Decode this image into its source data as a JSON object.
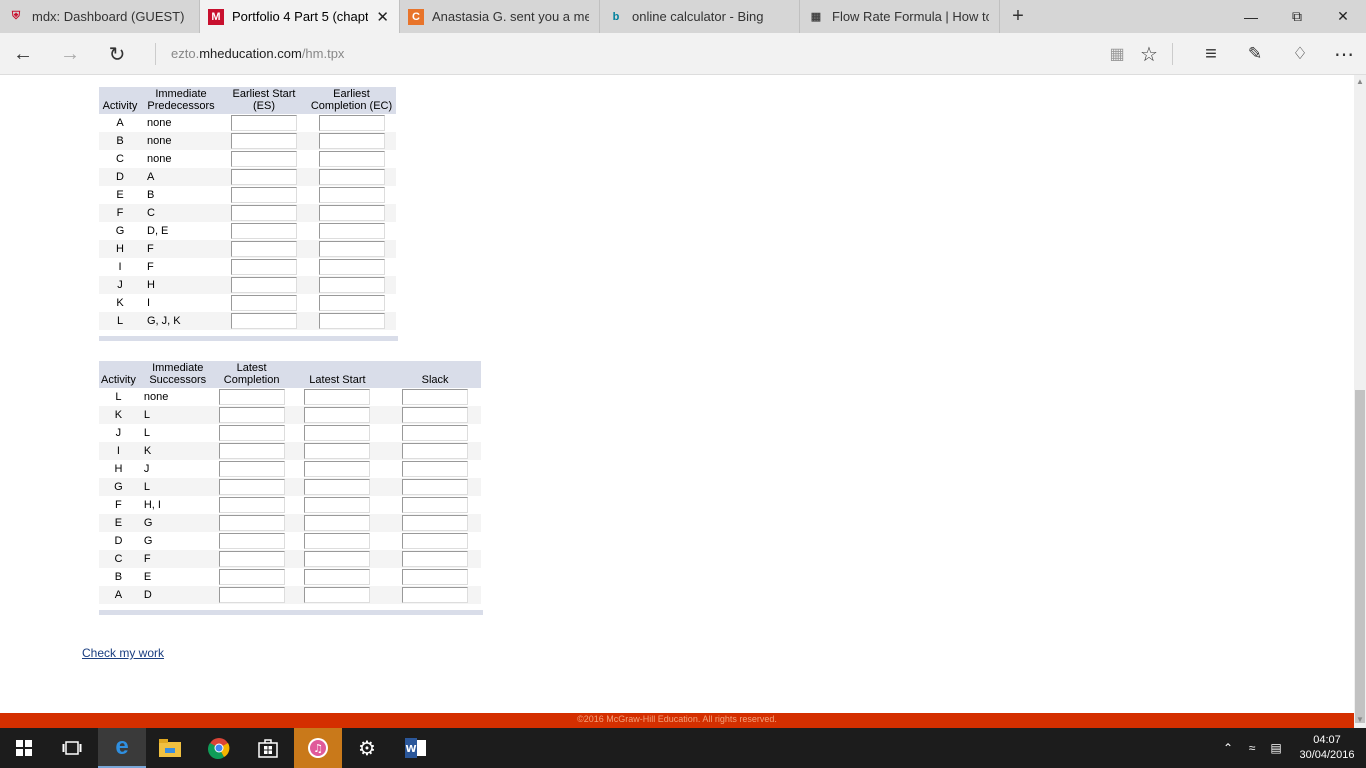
{
  "browser": {
    "tabs": [
      {
        "title": "mdx: Dashboard (GUEST)",
        "icon": "shield-icon",
        "color": "#c8102e",
        "active": false
      },
      {
        "title": "Portfolio 4 Part 5 (chapt",
        "icon": "m-logo-icon",
        "color": "#c8102e",
        "active": true
      },
      {
        "title": "Anastasia G. sent you a mes",
        "icon": "c-logo-icon",
        "color": "#e8742a",
        "active": false
      },
      {
        "title": "online calculator - Bing",
        "icon": "bing-icon",
        "color": "#00809d",
        "active": false
      },
      {
        "title": "Flow Rate Formula | How to",
        "icon": "page-icon",
        "color": "#444444",
        "active": false
      }
    ],
    "new_tab": "+",
    "url_prefix": "ezto.",
    "url_domain": "mheducation.com",
    "url_path": "/hm.tpx"
  },
  "forward_table": {
    "headers": [
      "Activity",
      "Immediate Predecessors",
      "Earliest Start (ES)",
      "Earliest Completion (EC)"
    ],
    "rows": [
      {
        "activity": "A",
        "pred": "none"
      },
      {
        "activity": "B",
        "pred": "none"
      },
      {
        "activity": "C",
        "pred": "none"
      },
      {
        "activity": "D",
        "pred": "A"
      },
      {
        "activity": "E",
        "pred": "B"
      },
      {
        "activity": "F",
        "pred": "C"
      },
      {
        "activity": "G",
        "pred": "D, E"
      },
      {
        "activity": "H",
        "pred": "F"
      },
      {
        "activity": "I",
        "pred": "F"
      },
      {
        "activity": "J",
        "pred": "H"
      },
      {
        "activity": "K",
        "pred": "I"
      },
      {
        "activity": "L",
        "pred": "G, J, K"
      }
    ]
  },
  "backward_table": {
    "headers": [
      "Activity",
      "Immediate Successors",
      "Latest Completion",
      "Latest Start",
      "Slack"
    ],
    "rows": [
      {
        "activity": "L",
        "succ": "none"
      },
      {
        "activity": "K",
        "succ": "L"
      },
      {
        "activity": "J",
        "succ": "L"
      },
      {
        "activity": "I",
        "succ": "K"
      },
      {
        "activity": "H",
        "succ": "J"
      },
      {
        "activity": "G",
        "succ": "L"
      },
      {
        "activity": "F",
        "succ": "H, I"
      },
      {
        "activity": "E",
        "succ": "G"
      },
      {
        "activity": "D",
        "succ": "G"
      },
      {
        "activity": "C",
        "succ": "F"
      },
      {
        "activity": "B",
        "succ": "E"
      },
      {
        "activity": "A",
        "succ": "D"
      }
    ]
  },
  "check_link": "Check my work",
  "footer": "©2016 McGraw-Hill Education. All rights reserved.",
  "taskbar": {
    "time": "04:07",
    "date": "30/04/2016"
  }
}
